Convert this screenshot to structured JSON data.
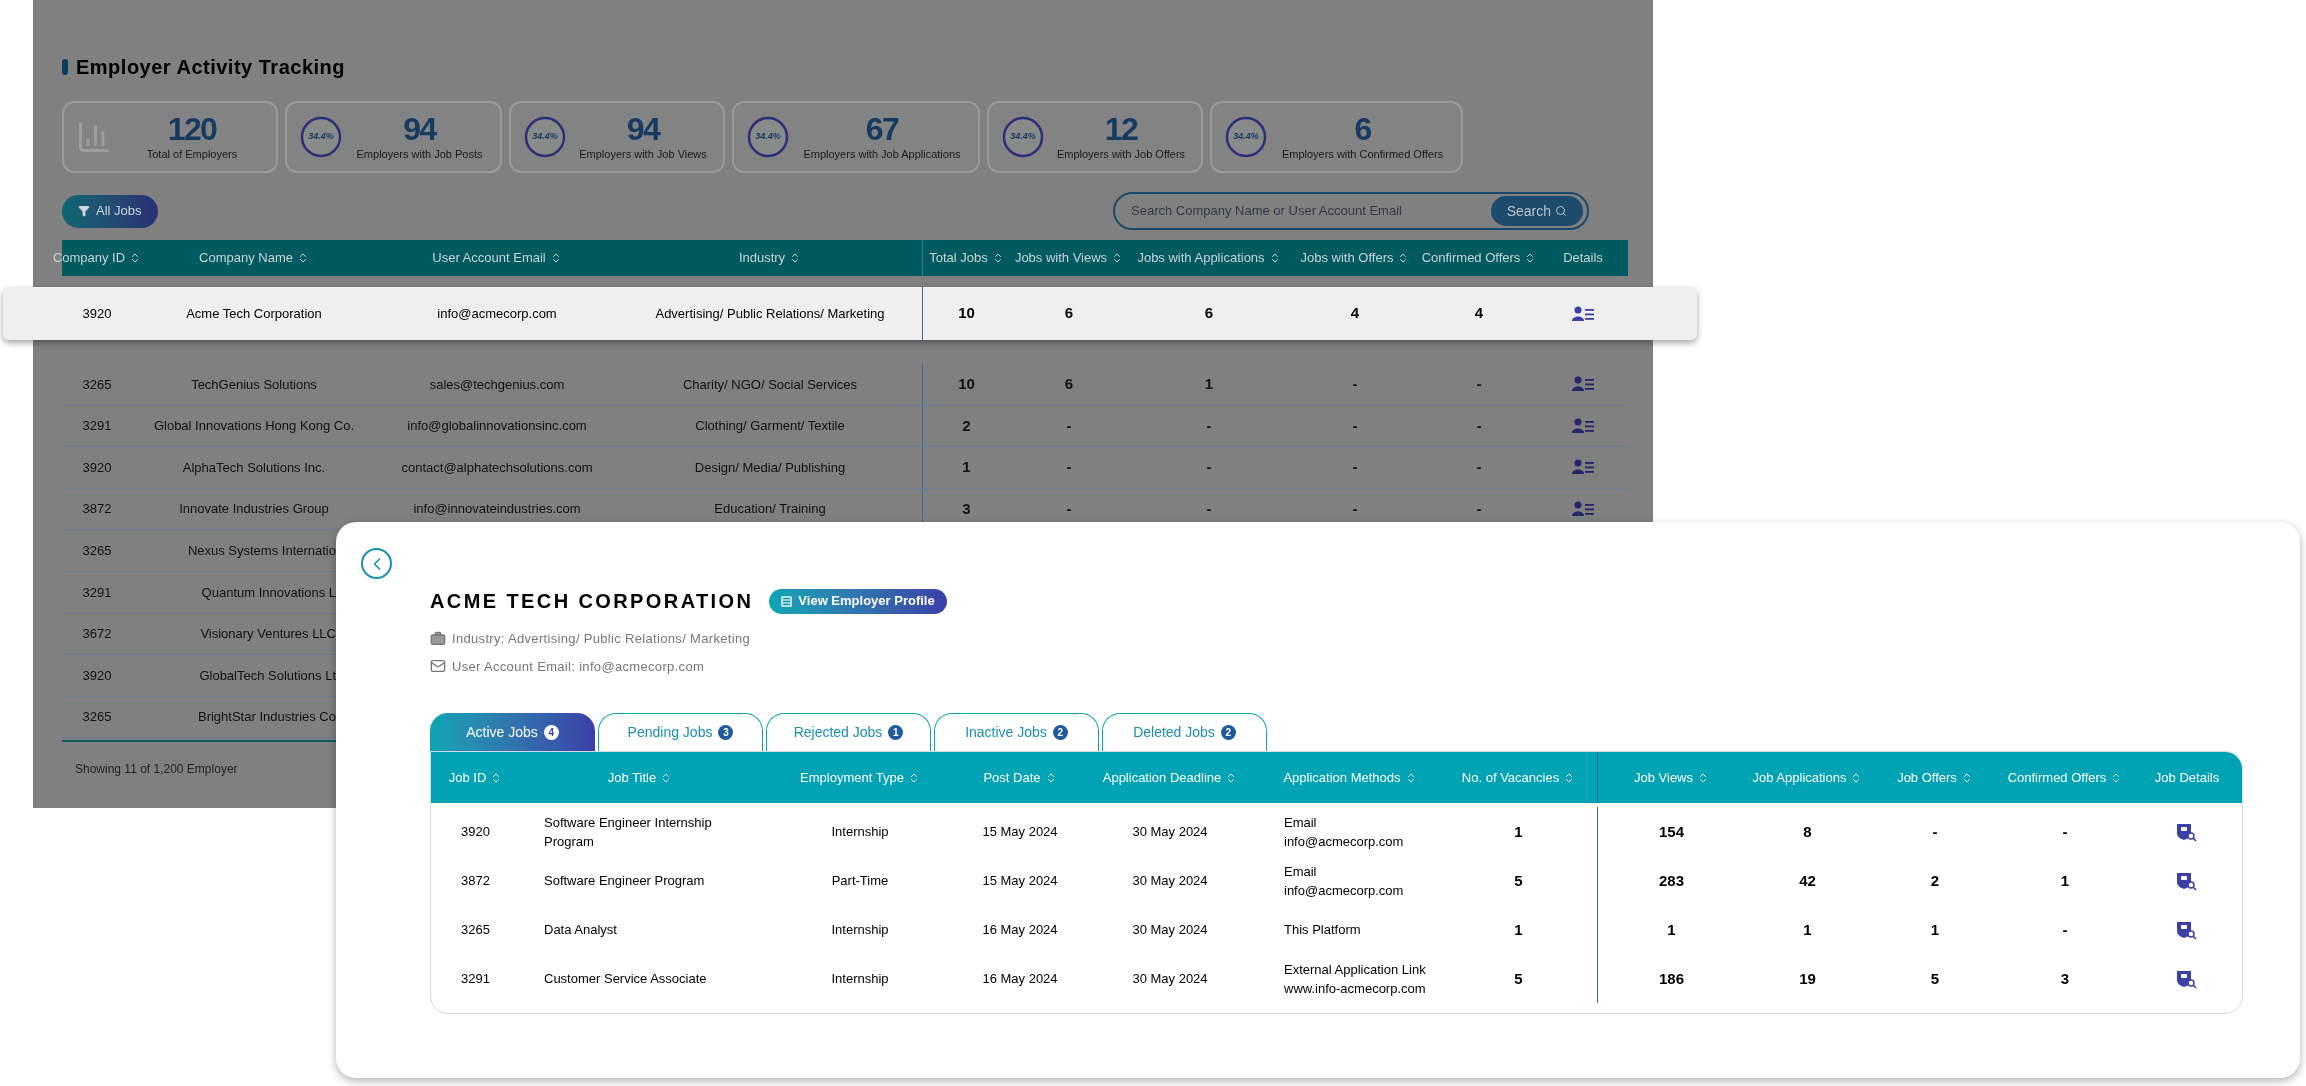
{
  "page_title": "Employer Activity Tracking",
  "stats": [
    {
      "kind": "total",
      "value": "120",
      "label": "Total of Employers"
    },
    {
      "kind": "ring",
      "percent": "34.4%",
      "value": "94",
      "label": "Employers with Job Posts"
    },
    {
      "kind": "ring",
      "percent": "34.4%",
      "value": "94",
      "label": "Employers with Job Views"
    },
    {
      "kind": "ring",
      "percent": "34.4%",
      "value": "67",
      "label": "Employers with Job Applications"
    },
    {
      "kind": "ring",
      "percent": "34.4%",
      "value": "12",
      "label": "Employers with Job Offers"
    },
    {
      "kind": "ring",
      "percent": "34.4%",
      "value": "6",
      "label": "Employers with Confirmed Offers"
    }
  ],
  "filter_button": "All Jobs",
  "search": {
    "placeholder": "Search Company Name or User Account Email",
    "button": "Search"
  },
  "employer_table": {
    "columns": [
      {
        "label": "Company ID",
        "sortable": true
      },
      {
        "label": "Company Name",
        "sortable": true
      },
      {
        "label": "User Account Email",
        "sortable": true
      },
      {
        "label": "Industry",
        "sortable": true
      },
      {
        "label": "Total Jobs",
        "sortable": true
      },
      {
        "label": "Jobs with Views",
        "sortable": true
      },
      {
        "label": "Jobs with Applications",
        "sortable": true
      },
      {
        "label": "Jobs with Offers",
        "sortable": true
      },
      {
        "label": "Confirmed Offers",
        "sortable": true
      },
      {
        "label": "Details",
        "sortable": false
      }
    ],
    "highlighted_row": {
      "cells": [
        "3920",
        "Acme Tech Corporation",
        "info@acmecorp.com",
        "Advertising/ Public Relations/ Marketing",
        "10",
        "6",
        "6",
        "4",
        "4"
      ]
    },
    "rows": [
      {
        "cells": [
          "3265",
          "TechGenius Solutions",
          "sales@techgenius.com",
          "Charity/ NGO/ Social Services",
          "10",
          "6",
          "1",
          "-",
          "-"
        ]
      },
      {
        "cells": [
          "3291",
          "Global Innovations Hong Kong Co.",
          "info@globalinnovationsinc.com",
          "Clothing/ Garment/ Textile",
          "2",
          "-",
          "-",
          "-",
          "-"
        ]
      },
      {
        "cells": [
          "3920",
          "AlphaTech Solutions Inc.",
          "contact@alphatechsolutions.com",
          "Design/ Media/ Publishing",
          "1",
          "-",
          "-",
          "-",
          "-"
        ]
      },
      {
        "cells": [
          "3872",
          "Innovate Industries Group",
          "info@innovateindustries.com",
          "Education/ Training",
          "3",
          "-",
          "-",
          "-",
          "-"
        ]
      },
      {
        "cells": [
          "3265",
          "Nexus Systems Internatio"
        ]
      },
      {
        "cells": [
          "3291",
          "Quantum Innovations L"
        ]
      },
      {
        "cells": [
          "3672",
          "Visionary Ventures LLC"
        ]
      },
      {
        "cells": [
          "3920",
          "GlobalTech Solutions Lt"
        ]
      },
      {
        "cells": [
          "3265",
          "BrightStar Industries Co"
        ]
      }
    ],
    "footer": "Showing 11 of 1,200 Employer"
  },
  "detail": {
    "company": "ACME TECH CORPORATION",
    "profile_button": "View Employer Profile",
    "industry": "Industry: Advertising/ Public Relations/ Marketing",
    "email": "User Account Email: info@acmecorp.com",
    "tabs": [
      {
        "label": "Active Jobs",
        "count": "4",
        "selected": true
      },
      {
        "label": "Pending Jobs",
        "count": "3",
        "selected": false
      },
      {
        "label": "Rejected Jobs",
        "count": "1",
        "selected": false
      },
      {
        "label": "Inactive Jobs",
        "count": "2",
        "selected": false
      },
      {
        "label": "Deleted Jobs",
        "count": "2",
        "selected": false
      }
    ],
    "columns": [
      {
        "label": "Job ID",
        "sortable": true
      },
      {
        "label": "Job Title",
        "sortable": true
      },
      {
        "label": "Employment Type",
        "sortable": true
      },
      {
        "label": "Post Date",
        "sortable": true
      },
      {
        "label": "Application Deadline",
        "sortable": true
      },
      {
        "label": "Application Methods",
        "sortable": true
      },
      {
        "label": "No. of Vacancies",
        "sortable": true
      },
      {
        "label": "Job Views",
        "sortable": true
      },
      {
        "label": "Job Applications",
        "sortable": true
      },
      {
        "label": "Job Offers",
        "sortable": true
      },
      {
        "label": "Confirmed Offers",
        "sortable": true
      },
      {
        "label": "Job Details",
        "sortable": false
      }
    ],
    "rows": [
      {
        "cells": [
          "3920",
          "Software Engineer Internship Program",
          "Internship",
          "15 May 2024",
          "30 May 2024",
          "Email\ninfo@acmecorp.com",
          "1",
          "154",
          "8",
          "-",
          "-"
        ]
      },
      {
        "cells": [
          "3872",
          "Software Engineer Program",
          "Part-Time",
          "15 May 2024",
          "30 May 2024",
          "Email\ninfo@acmecorp.com",
          "5",
          "283",
          "42",
          "2",
          "1"
        ]
      },
      {
        "cells": [
          "3265",
          "Data Analyst",
          "Internship",
          "16 May 2024",
          "30 May 2024",
          "This Platform",
          "1",
          "1",
          "1",
          "1",
          "-"
        ]
      },
      {
        "cells": [
          "3291",
          "Customer Service Associate",
          "Internship",
          "16 May 2024",
          "30 May 2024",
          "External Application Link\nwww.info-acmecorp.com",
          "5",
          "186",
          "19",
          "5",
          "3"
        ]
      }
    ]
  }
}
